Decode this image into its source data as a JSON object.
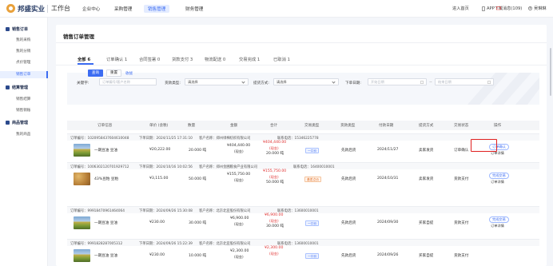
{
  "header": {
    "brand": "邦盛实业",
    "workbench": "工作台",
    "nav": [
      "企业中心",
      "采购管理",
      "销售管理",
      "财务管理"
    ],
    "active_nav": "销售管理",
    "enter_home": "进入首页",
    "app_download": "APP下载",
    "messages": "消息(109)",
    "user": "吴琳琳"
  },
  "sidebar": {
    "groups": [
      {
        "title": "销售订单",
        "items": [
          "我的采购",
          "我的分销",
          "点价管理",
          "销售订单"
        ]
      },
      {
        "title": "结算管理",
        "items": [
          "销售结算",
          "销售销账"
        ]
      },
      {
        "title": "商品管理",
        "items": [
          "我的商品"
        ]
      }
    ],
    "active_item": "销售订单"
  },
  "page": {
    "title": "销售订单管理",
    "tabs": [
      "全部 6",
      "订单确认 1",
      "合同签署 0",
      "货款支付 3",
      "物流配送 0",
      "交易完成 1",
      "已取消 1"
    ],
    "active_tab": "全部 6"
  },
  "filter": {
    "keyword_label": "关键字:",
    "keyword_placeholder": "订单编号/客户名称",
    "payment_type_label": "货款类型:",
    "payment_type_value": "请选择",
    "delivery_label": "提货方式:",
    "delivery_value": "请选择",
    "order_date_label": "下单日期:",
    "start_placeholder": "开始日期",
    "end_placeholder": "结束日期",
    "date_sep": "~",
    "query_button": "查询",
    "reset_button": "重置",
    "collapse_link": "收拢"
  },
  "table": {
    "columns": [
      "订单信息",
      "单价 (含税)",
      "数量",
      "金额",
      "合计",
      "交易类型",
      "货款类型",
      "付款日期",
      "提货方式",
      "交易状态",
      "操作"
    ]
  },
  "orders": [
    {
      "order_no": "订单编号：10209584376046100​48",
      "order_date": "下单日期：2024/11/25 17:31:10",
      "customer": "客户名称：郑州绿棉纺织有限公司",
      "contact": "联系电话：15346225778",
      "product": "一期豆油 豆油",
      "image": "field",
      "unit_price": "¥20,222.00",
      "quantity": "20.000 吨",
      "amount": "¥404,440.00",
      "amount_note": "(现金)",
      "total": "¥404,440.00",
      "total_note": "(现金)",
      "total_qty": "20.000 吨",
      "trade_type": "一口价",
      "trade_color": "blue",
      "payment_type": "先款后货",
      "pay_date": "2024/11/27",
      "delivery": "卖家发货",
      "status": "订单确认",
      "actions": [
        "订单确认",
        "订单详情"
      ]
    },
    {
      "order_no": "订单编号：10063021207019​29712",
      "order_date": "下单日期：2024/10/16 10:02:56",
      "customer": "客户名称：郑州金圃粮食产业有限公司",
      "contact": "联系电话：16400010001",
      "product": "43%豆粕 豆粕",
      "image": "seed",
      "unit_price": "¥3,115.00",
      "quantity": "50.000 吨",
      "amount": "¥155,750.00",
      "amount_note": "(现金)",
      "total": "¥155,750.00",
      "total_note": "(现金)",
      "total_qty": "50.000 吨",
      "trade_type": "基差点价",
      "trade_color": "orange",
      "payment_type": "先款后货",
      "pay_date": "2024/10/31",
      "delivery": "卖家发货",
      "status": "货款支付",
      "actions": [
        "完成交易",
        "订单详情"
      ]
    },
    {
      "order_no": "订单编号：99918470961464064",
      "order_date": "下单日期：2024/09/26 15:30:08",
      "customer": "客户名称：北京北亚股份有限公司",
      "contact": "联系电话：13600010001",
      "product": "一期豆油 豆油",
      "image": "field",
      "unit_price": "¥230.00",
      "quantity": "30.000 吨",
      "amount": "¥6,900.00",
      "amount_note": "(现金)",
      "total": "¥6,900.00",
      "total_note": "(现金)",
      "total_qty": "30.000 吨",
      "trade_type": "一口价",
      "trade_color": "blue",
      "payment_type": "先款后货",
      "pay_date": "2024/09/30",
      "delivery": "买家自提",
      "status": "货款支付",
      "actions": [
        "完成交易",
        "订单详情"
      ]
    },
    {
      "order_no": "订单编号：99918282870​0​5312",
      "order_date": "下单日期：2024/09/26 15:22:39",
      "customer": "客户名称：北京北亚股份有限公司",
      "contact": "联系电话：13600010001",
      "product": "一期豆油 豆油",
      "image": "field",
      "unit_price": "¥230.00",
      "quantity": "10.000 吨",
      "amount": "¥2,300.00",
      "amount_note": "(现金)",
      "total": "¥2,300.00",
      "total_note": "(现金)",
      "total_qty": "",
      "trade_type": "一口价",
      "trade_color": "blue",
      "payment_type": "先款后货",
      "pay_date": "2024/09/26",
      "delivery": "买家自提",
      "status": "货款支付",
      "actions": []
    }
  ]
}
